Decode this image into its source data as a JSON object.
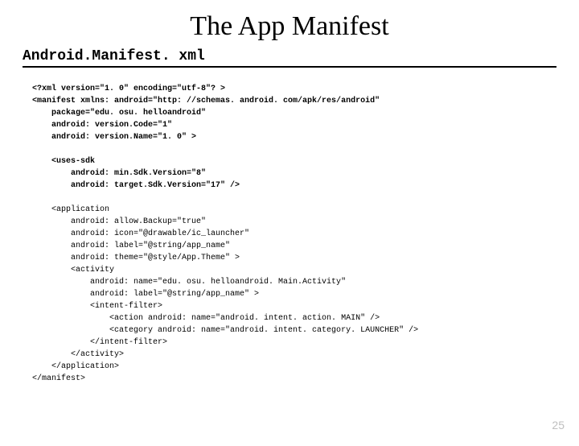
{
  "title": "The App Manifest",
  "filename": "Android.Manifest. xml",
  "code": {
    "l1": "<?xml version=\"1. 0\" encoding=\"utf-8\"? >",
    "l2": "<manifest xmlns: android=\"http: //schemas. android. com/apk/res/android\"",
    "l3": "    package=\"edu. osu. helloandroid\"",
    "l4": "    android: version.Code=\"1\"",
    "l5": "    android: version.Name=\"1. 0\" >",
    "l6": "    <uses-sdk",
    "l7": "        android: min.Sdk.Version=\"8\"",
    "l8": "        android: target.Sdk.Version=\"17\" />",
    "l9": "    <application",
    "l10": "        android: allow.Backup=\"true\"",
    "l11": "        android: icon=\"@drawable/ic_launcher\"",
    "l12": "        android: label=\"@string/app_name\"",
    "l13": "        android: theme=\"@style/App.Theme\" >",
    "l14": "        <activity",
    "l15": "            android: name=\"edu. osu. helloandroid. Main.Activity\"",
    "l16": "            android: label=\"@string/app_name\" >",
    "l17": "            <intent-filter>",
    "l18": "                <action android: name=\"android. intent. action. MAIN\" />",
    "l19": "                <category android: name=\"android. intent. category. LAUNCHER\" />",
    "l20": "            </intent-filter>",
    "l21": "        </activity>",
    "l22": "    </application>",
    "l23": "</manifest>"
  },
  "page_number": "25"
}
